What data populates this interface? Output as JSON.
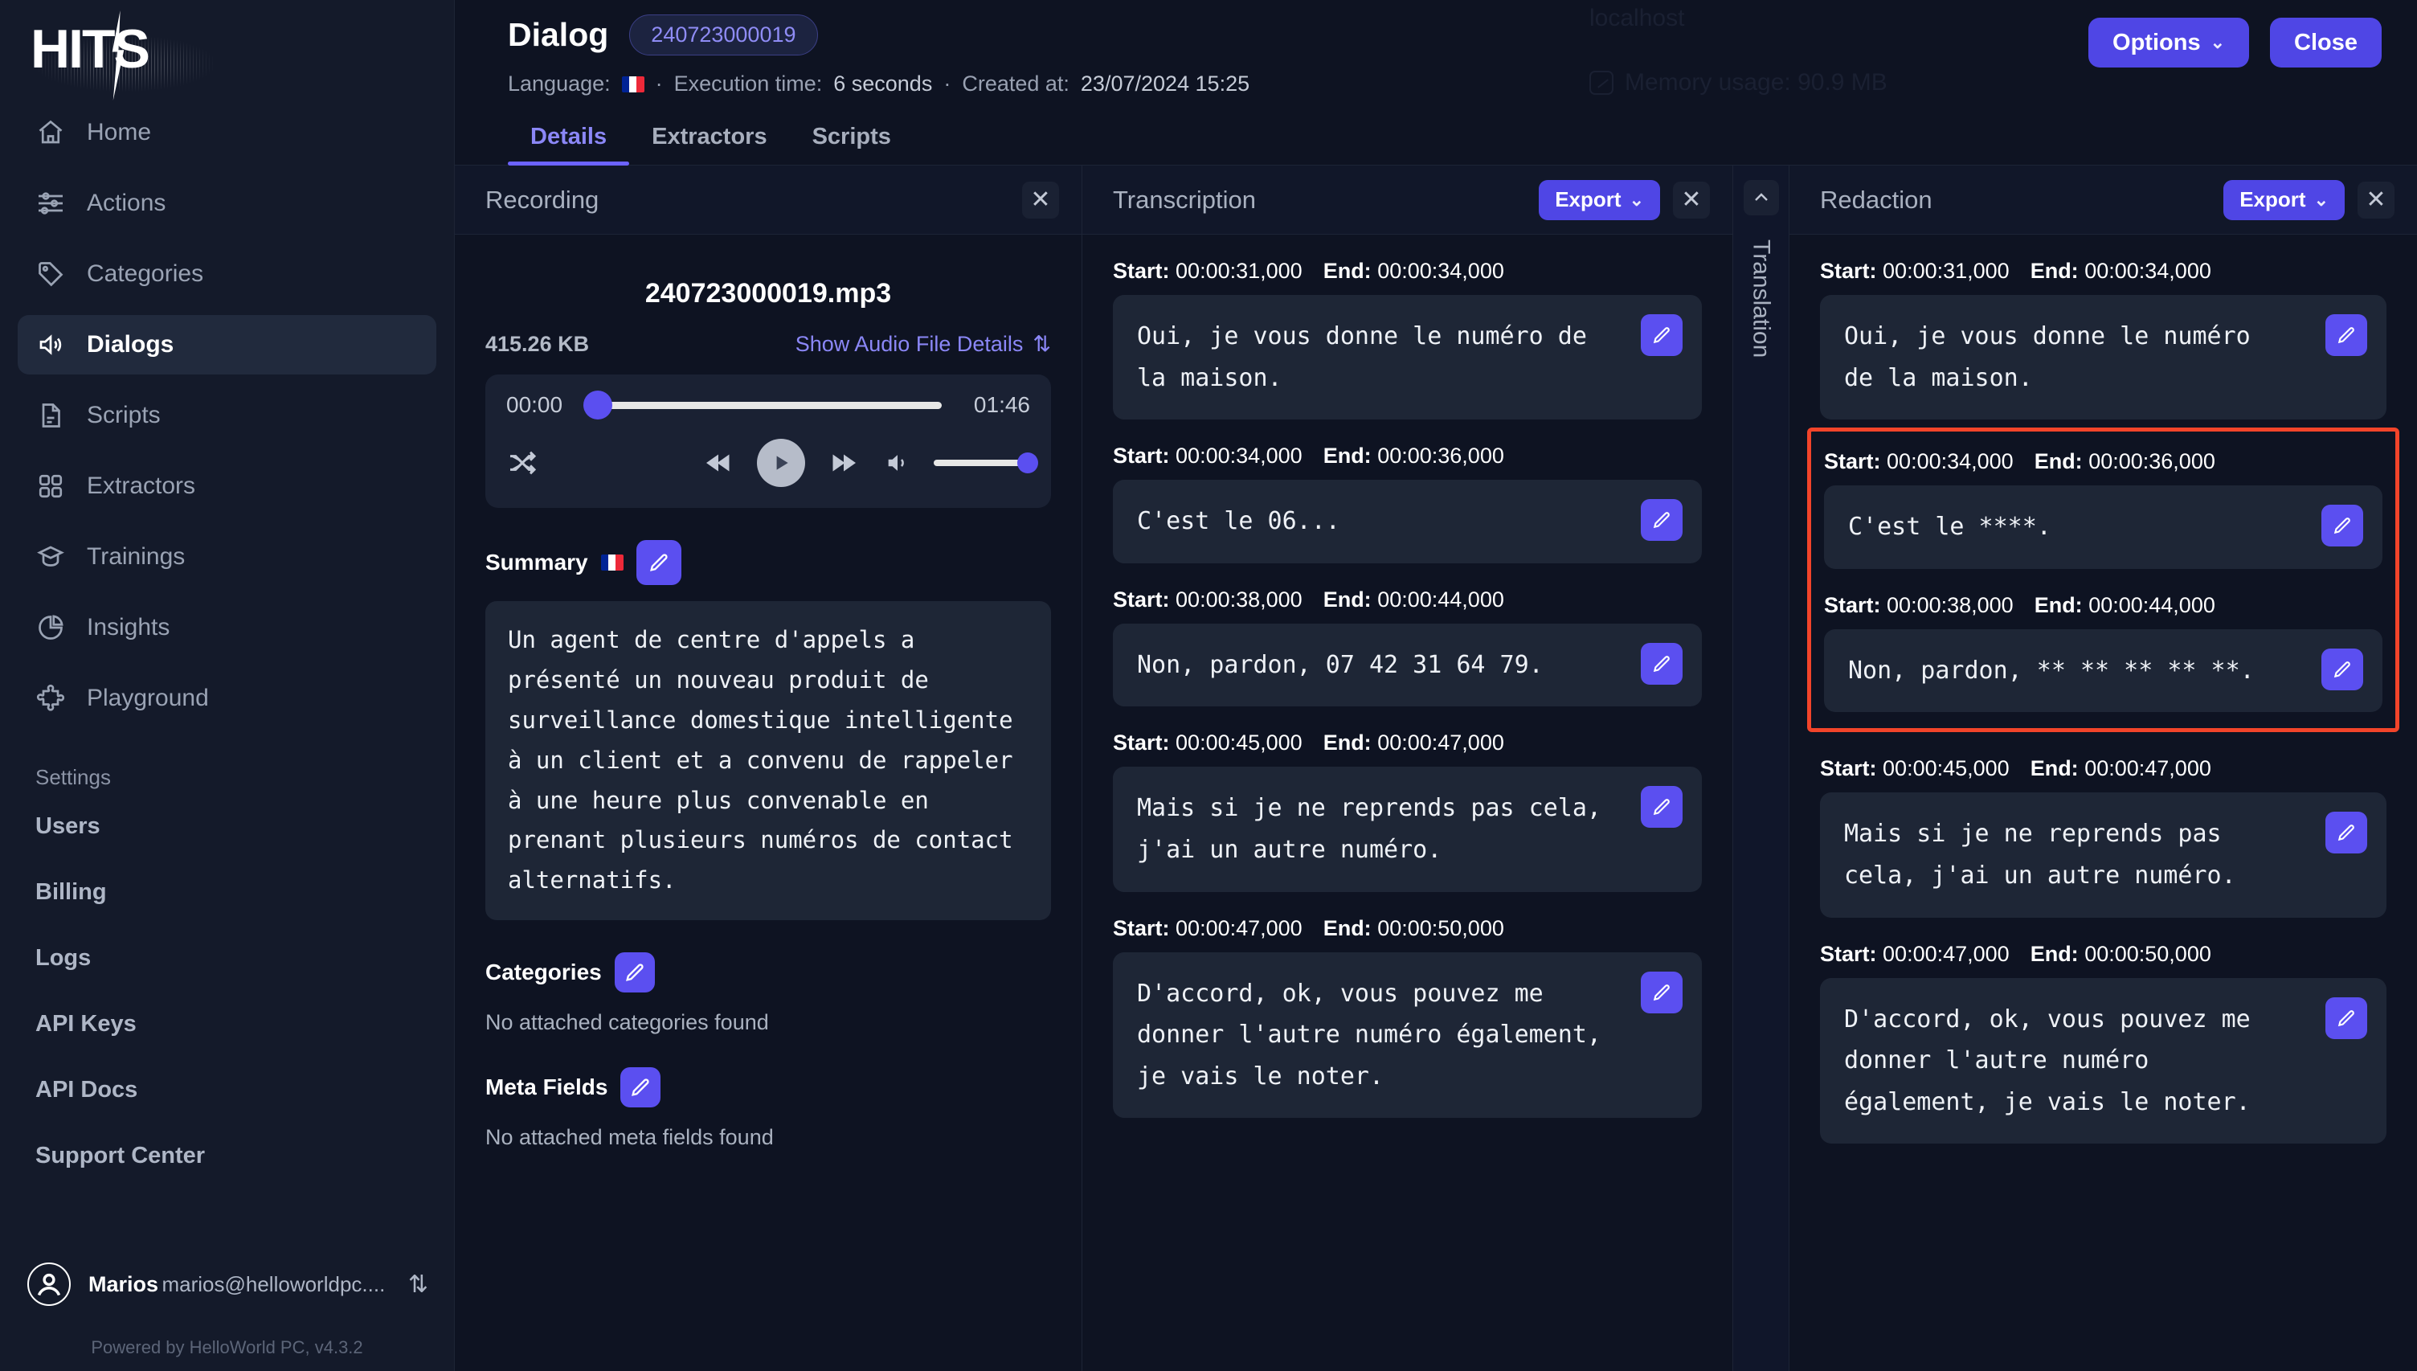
{
  "brand": {
    "logo_text": "HITS",
    "powered_by": "Powered by HelloWorld PC, v4.3.2"
  },
  "background_ghost": {
    "host": "localhost",
    "memory": "Memory usage: 90.9 MB"
  },
  "sidebar": {
    "items": [
      {
        "label": "Home",
        "icon": "home-icon"
      },
      {
        "label": "Actions",
        "icon": "sliders-icon"
      },
      {
        "label": "Categories",
        "icon": "tag-icon"
      },
      {
        "label": "Dialogs",
        "icon": "speaker-icon"
      },
      {
        "label": "Scripts",
        "icon": "document-icon"
      },
      {
        "label": "Extractors",
        "icon": "grid-icon"
      },
      {
        "label": "Trainings",
        "icon": "graduation-cap-icon"
      },
      {
        "label": "Insights",
        "icon": "pie-chart-icon"
      },
      {
        "label": "Playground",
        "icon": "puzzle-icon"
      }
    ],
    "active_item": "Dialogs",
    "settings_label": "Settings",
    "settings_items": [
      "Users",
      "Billing",
      "Logs",
      "API Keys",
      "API Docs",
      "Support Center"
    ],
    "user": {
      "name": "Marios",
      "email": "marios@helloworldpc...."
    }
  },
  "header": {
    "title": "Dialog",
    "id_badge": "240723000019",
    "language_label": "Language:",
    "language_flag": "fr",
    "exec_label": "Execution time:",
    "exec_value": "6 seconds",
    "created_label": "Created at:",
    "created_value": "23/07/2024 15:25",
    "options_button": "Options",
    "close_button": "Close",
    "tabs": [
      {
        "label": "Details",
        "active": true
      },
      {
        "label": "Extractors",
        "active": false
      },
      {
        "label": "Scripts",
        "active": false
      }
    ]
  },
  "recording": {
    "panel_title": "Recording",
    "file_name": "240723000019.mp3",
    "file_size": "415.26 KB",
    "details_link": "Show Audio File Details",
    "player": {
      "current_time": "00:00",
      "total_time": "01:46",
      "progress_pct": 0,
      "volume_pct": 100
    },
    "summary_label": "Summary",
    "summary_text": "Un agent de centre d'appels a présenté un nouveau produit de surveillance domestique intelligente à un client et a convenu de rappeler à une heure plus convenable en prenant plusieurs numéros de contact alternatifs.",
    "categories_label": "Categories",
    "categories_empty": "No attached categories found",
    "meta_fields_label": "Meta Fields",
    "meta_fields_empty": "No attached meta fields found"
  },
  "transcription": {
    "panel_title": "Transcription",
    "export_button": "Export",
    "start_label": "Start:",
    "end_label": "End:",
    "segments": [
      {
        "start": "00:00:31,000",
        "end": "00:00:34,000",
        "text": "Oui, je vous donne le numéro de la maison."
      },
      {
        "start": "00:00:34,000",
        "end": "00:00:36,000",
        "text": "C'est le 06..."
      },
      {
        "start": "00:00:38,000",
        "end": "00:00:44,000",
        "text": "Non, pardon, 07 42 31 64 79."
      },
      {
        "start": "00:00:45,000",
        "end": "00:00:47,000",
        "text": "Mais si je ne reprends pas cela, j'ai un autre numéro."
      },
      {
        "start": "00:00:47,000",
        "end": "00:00:50,000",
        "text": "D'accord, ok, vous pouvez me donner l'autre numéro également, je vais le noter."
      }
    ]
  },
  "translation": {
    "label": "Translation",
    "collapsed": true
  },
  "redaction": {
    "panel_title": "Redaction",
    "export_button": "Export",
    "start_label": "Start:",
    "end_label": "End:",
    "highlight_color": "#f2442a",
    "segments": [
      {
        "start": "00:00:31,000",
        "end": "00:00:34,000",
        "text": "Oui, je vous donne le numéro de la maison.",
        "highlighted": false
      },
      {
        "start": "00:00:34,000",
        "end": "00:00:36,000",
        "text": "C'est le ****.",
        "highlighted": true
      },
      {
        "start": "00:00:38,000",
        "end": "00:00:44,000",
        "text": "Non, pardon, ** ** ** ** **.",
        "highlighted": true
      },
      {
        "start": "00:00:45,000",
        "end": "00:00:47,000",
        "text": "Mais si je ne reprends pas cela, j'ai un autre numéro.",
        "highlighted": false
      },
      {
        "start": "00:00:47,000",
        "end": "00:00:50,000",
        "text": "D'accord, ok, vous pouvez me donner l'autre numéro également, je vais le noter.",
        "highlighted": false
      }
    ]
  },
  "colors": {
    "accent": "#5b4ff0",
    "accent_text": "#8b87f7",
    "danger": "#f2442a",
    "panel_bg": "#1e2636"
  }
}
